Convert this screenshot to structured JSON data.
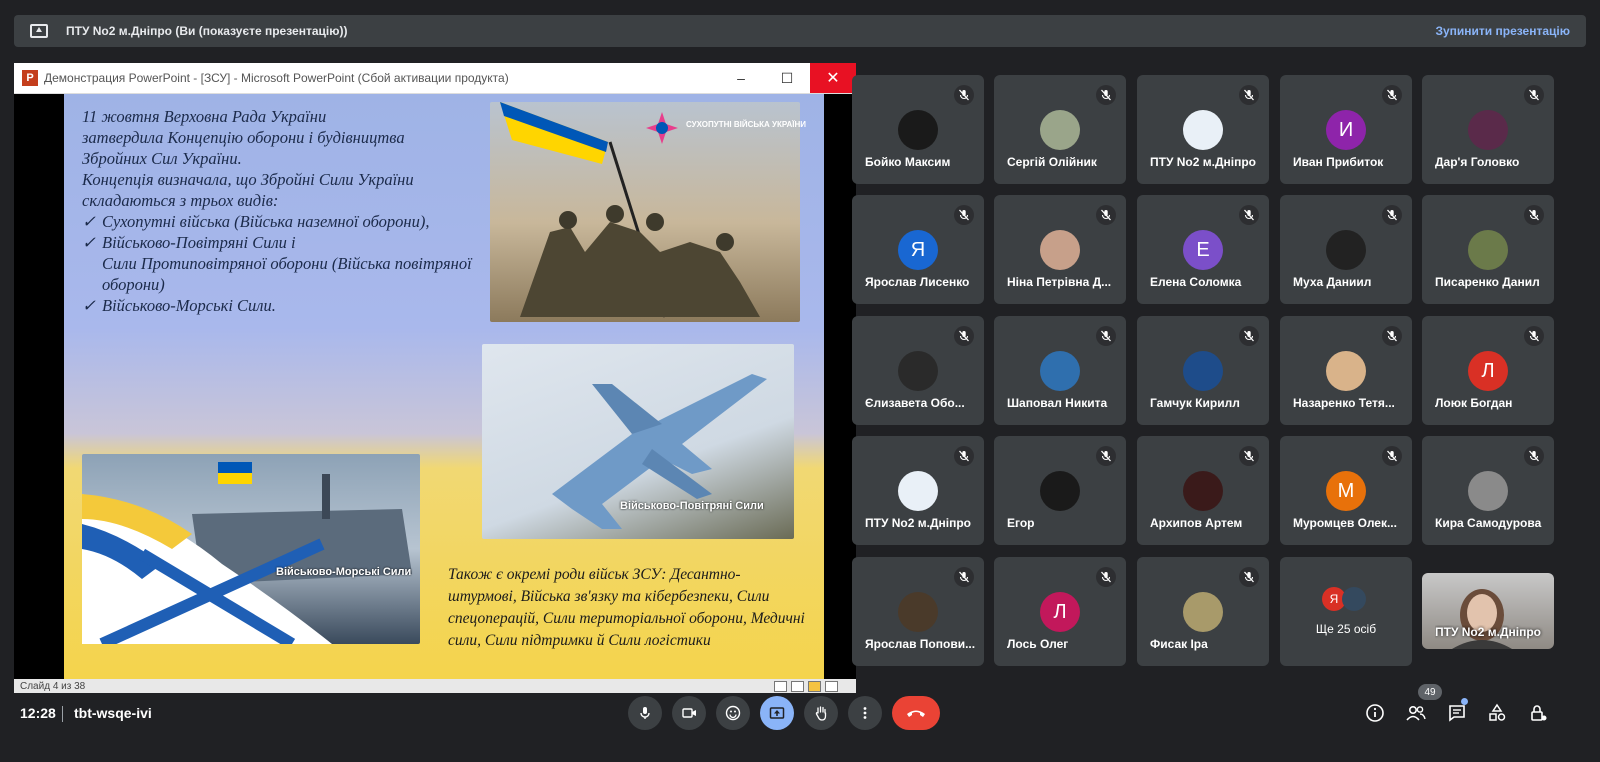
{
  "colors": {
    "background": "#202124",
    "tile": "#3c4043",
    "accent": "#8ab4f8",
    "leave": "#ea4335"
  },
  "topbar": {
    "title": "ПТУ No2 м.Дніпро (Ви (показуєте презентацію))",
    "stop_label": "Зупинити презентацію",
    "icon": "present-to-all-icon"
  },
  "ppt": {
    "window_title": "Демонстрация PowerPoint - [ЗСУ] - Microsoft PowerPoint (Сбой активации продукта)",
    "minimize": "–",
    "maximize": "☐",
    "close": "✕",
    "status": "Слайд 4 из 38",
    "slide": {
      "lines": [
        "11 жовтня Верховна Рада України",
        "затвердила Концепцію оборони і будівництва",
        "Збройних Сил України.",
        "Концепція визначала, що Збройні Сили України",
        "складаються з трьох видів:"
      ],
      "bullets": [
        "Сухопутні війська (Війська наземної оборони),",
        "Військово-Повітряні Сили  і",
        "Сили Протиповітряної оборони (Війська повітряної оборони)",
        "Військово-Морські Сили."
      ],
      "emblem_text": "СУХОПУТНІ ВІЙСЬКА УКРАЇНИ",
      "caption_air": "Військово-Повітряні Сили",
      "caption_navy": "Військово-Морські Сили",
      "bottom_text": "Також є окремі роди військ ЗСУ: Десантно-штурмові, Війська зв'язку та кібербезпеки, Сили спецоперацій, Сили територіальної оборони, Медичні сили, Сили підтримки й Сили логістики"
    }
  },
  "participants": [
    {
      "name": "Бойко Максим",
      "avatar_text": "",
      "avatar_color": "#1a1a1a"
    },
    {
      "name": "Сергій Олійник",
      "avatar_text": "",
      "avatar_color": "#9aa58a"
    },
    {
      "name": "ПТУ No2 м.Дніпро",
      "avatar_text": "",
      "avatar_color": "#e9f0f7"
    },
    {
      "name": "Иван Прибиток",
      "avatar_text": "И",
      "avatar_color": "#8e24aa"
    },
    {
      "name": "Дар'я Головко",
      "avatar_text": "",
      "avatar_color": "#5a2a4a"
    },
    {
      "name": "Ярослав Лисенко",
      "avatar_text": "Я",
      "avatar_color": "#1967d2"
    },
    {
      "name": "Ніна Петрівна Д...",
      "avatar_text": "",
      "avatar_color": "#c7a08a"
    },
    {
      "name": "Елена Соломка",
      "avatar_text": "Е",
      "avatar_color": "#7b4fc9"
    },
    {
      "name": "Муха Даниил",
      "avatar_text": "",
      "avatar_color": "#222222"
    },
    {
      "name": "Писаренко Данил",
      "avatar_text": "",
      "avatar_color": "#6b7a4a"
    },
    {
      "name": "Єлизавета Обо...",
      "avatar_text": "",
      "avatar_color": "#2a2a2a"
    },
    {
      "name": "Шаповал Никита",
      "avatar_text": "",
      "avatar_color": "#2f6fae"
    },
    {
      "name": "Гамчук Кирилл",
      "avatar_text": "",
      "avatar_color": "#1e4c8a"
    },
    {
      "name": "Назаренко Тетя...",
      "avatar_text": "",
      "avatar_color": "#d9b38a"
    },
    {
      "name": "Лоюк Богдан",
      "avatar_text": "Л",
      "avatar_color": "#d93025"
    },
    {
      "name": "ПТУ No2 м.Дніпро",
      "avatar_text": "",
      "avatar_color": "#e9f0f7"
    },
    {
      "name": "Егор",
      "avatar_text": "",
      "avatar_color": "#1a1a1a"
    },
    {
      "name": "Архипов Артем",
      "avatar_text": "",
      "avatar_color": "#3a1a1a"
    },
    {
      "name": "Муромцев Олек...",
      "avatar_text": "М",
      "avatar_color": "#e8710a"
    },
    {
      "name": "Кира Самодурова",
      "avatar_text": "",
      "avatar_color": "#8a8a8a"
    },
    {
      "name": "Ярослав Попови...",
      "avatar_text": "",
      "avatar_color": "#4a3a2a"
    },
    {
      "name": "Лось Олег",
      "avatar_text": "Л",
      "avatar_color": "#c2185b"
    },
    {
      "name": "Фисак Іра",
      "avatar_text": "",
      "avatar_color": "#a89a6a"
    }
  ],
  "more_tile": {
    "label": "Ще 25 осіб",
    "mini_avatar_text": "Я",
    "mini_avatar_color": "#d93025"
  },
  "self_tile": {
    "name": "ПТУ No2 м.Дніпро"
  },
  "bottombar": {
    "time": "12:28",
    "meeting_code": "tbt-wsqe-ivi",
    "people_count": "49"
  }
}
